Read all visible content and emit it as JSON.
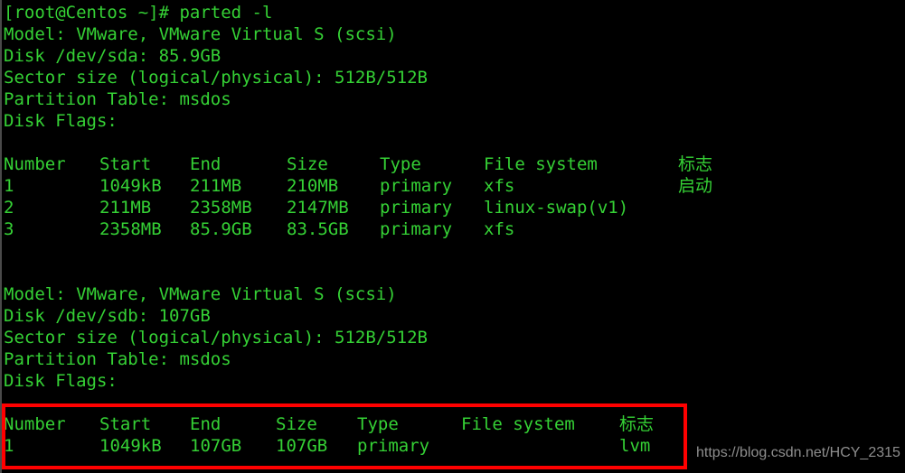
{
  "terminal": {
    "prompt_line": "[root@Centos ~]# parted -l",
    "disk_sda": {
      "model": "Model: VMware, VMware Virtual S (scsi)",
      "disk": "Disk /dev/sda: 85.9GB",
      "sector_size": "Sector size (logical/physical): 512B/512B",
      "partition_table": "Partition Table: msdos",
      "disk_flags": "Disk Flags:",
      "table": {
        "headers": [
          "Number",
          "Start",
          "End",
          "Size",
          "Type",
          "File system",
          "标志"
        ],
        "rows": [
          [
            "1",
            "1049kB",
            "211MB",
            "210MB",
            "primary",
            "xfs",
            "启动"
          ],
          [
            "2",
            "211MB",
            "2358MB",
            "2147MB",
            "primary",
            "linux-swap(v1)",
            ""
          ],
          [
            "3",
            "2358MB",
            "85.9GB",
            "83.5GB",
            "primary",
            "xfs",
            ""
          ]
        ]
      }
    },
    "disk_sdb": {
      "model": "Model: VMware, VMware Virtual S (scsi)",
      "disk": "Disk /dev/sdb: 107GB",
      "sector_size": "Sector size (logical/physical): 512B/512B",
      "partition_table": "Partition Table: msdos",
      "disk_flags": "Disk Flags:",
      "table": {
        "headers": [
          "Number",
          "Start",
          "End",
          "Size",
          "Type",
          "File system",
          "标志"
        ],
        "rows": [
          [
            "1",
            "1049kB",
            "107GB",
            "107GB",
            "primary",
            "",
            "lvm"
          ]
        ]
      }
    }
  },
  "annotation": {
    "highlight_color": "#ff0000"
  },
  "watermark": {
    "text": "https://blog.csdn.net/HCY_2315",
    "color": "#8e8e8e"
  },
  "theme": {
    "background": "#000000",
    "foreground": "#35d135"
  }
}
